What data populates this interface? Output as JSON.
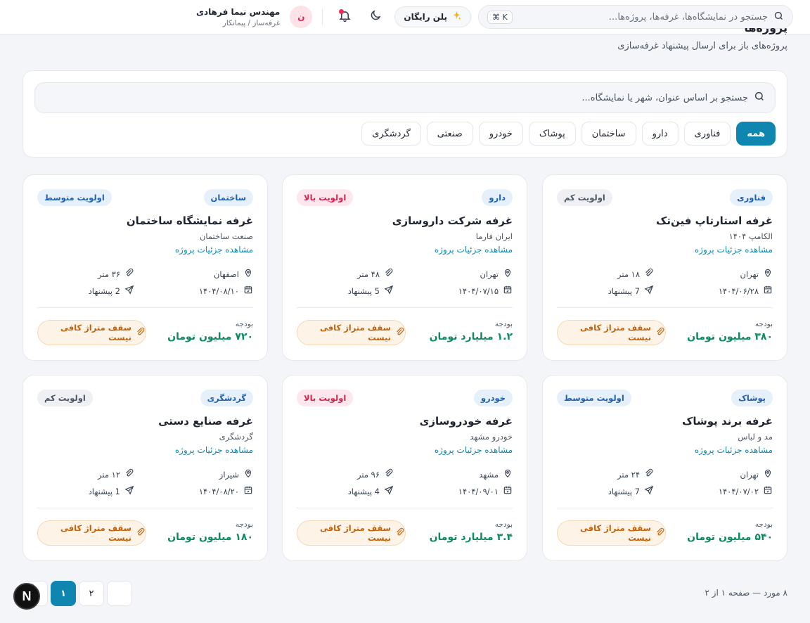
{
  "header": {
    "search_placeholder": "جستجو در نمایشگاه‌ها، غرفه‌ها، پروژه‌ها...",
    "shortcut": "⌘ K",
    "plan_label": "پلن رایگان",
    "user_name": "مهندس نیما فرهادی",
    "user_role": "غرفه‌ساز / پیمانکار",
    "avatar_letter": "ن"
  },
  "page": {
    "title": "پروژه‌ها",
    "subtitle": "پروژه‌های باز برای ارسال پیشنهاد غرفه‌سازی"
  },
  "filters": {
    "search_placeholder": "جستجو بر اساس عنوان، شهر یا نمایشگاه...",
    "chips": [
      "همه",
      "فناوری",
      "دارو",
      "ساختمان",
      "پوشاک",
      "خودرو",
      "صنعتی",
      "گردشگری"
    ],
    "active_chip": "همه"
  },
  "labels": {
    "details_link": "مشاهده جزئیات پروژه",
    "budget": "بودجه",
    "warning": "سقف متراژ کافی نیست"
  },
  "projects": [
    {
      "category": "فناوری",
      "priority": "اولویت کم",
      "title": "غرفه استارتاپ فین‌تک",
      "org": "الکامپ ۱۴۰۴",
      "city": "تهران",
      "area": "۱۸ متر",
      "date": "۱۴۰۴/۰۶/۲۸",
      "proposals": "7 پیشنهاد",
      "budget": "۳۸۰ میلیون تومان"
    },
    {
      "category": "دارو",
      "priority": "اولویت بالا",
      "title": "غرفه شرکت داروسازی",
      "org": "ایران فارما",
      "city": "تهران",
      "area": "۴۸ متر",
      "date": "۱۴۰۴/۰۷/۱۵",
      "proposals": "5 پیشنهاد",
      "budget": "۱.۲ میلیارد تومان"
    },
    {
      "category": "ساختمان",
      "priority": "اولویت متوسط",
      "title": "غرفه نمایشگاه ساختمان",
      "org": "صنعت ساختمان",
      "city": "اصفهان",
      "area": "۳۶ متر",
      "date": "۱۴۰۴/۰۸/۱۰",
      "proposals": "2 پیشنهاد",
      "budget": "۷۲۰ میلیون تومان"
    },
    {
      "category": "پوشاک",
      "priority": "اولویت متوسط",
      "title": "غرفه برند پوشاک",
      "org": "مد و لباس",
      "city": "تهران",
      "area": "۲۴ متر",
      "date": "۱۴۰۴/۰۷/۰۲",
      "proposals": "7 پیشنهاد",
      "budget": "۵۴۰ میلیون تومان"
    },
    {
      "category": "خودرو",
      "priority": "اولویت بالا",
      "title": "غرفه خودروسازی",
      "org": "خودرو مشهد",
      "city": "مشهد",
      "area": "۹۶ متر",
      "date": "۱۴۰۴/۰۹/۰۱",
      "proposals": "4 پیشنهاد",
      "budget": "۳.۴ میلیارد تومان"
    },
    {
      "category": "گردشگری",
      "priority": "اولویت کم",
      "title": "غرفه صنایع دستی",
      "org": "گردشگری",
      "city": "شیراز",
      "area": "۱۲ متر",
      "date": "۱۴۰۴/۰۸/۲۰",
      "proposals": "1 پیشنهاد",
      "budget": "۱۸۰ میلیون تومان"
    }
  ],
  "pagination": {
    "summary": "۸ مورد — صفحه ۱ از ۲",
    "pages": [
      "۱",
      "۲"
    ],
    "current": "۱",
    "prev_icon": "chevron-left-icon"
  },
  "colors": {
    "accent": "#0e86b0",
    "budget_green": "#0e8a5f",
    "warning_orange": "#c2620a",
    "priority_high": "#d1224d"
  }
}
